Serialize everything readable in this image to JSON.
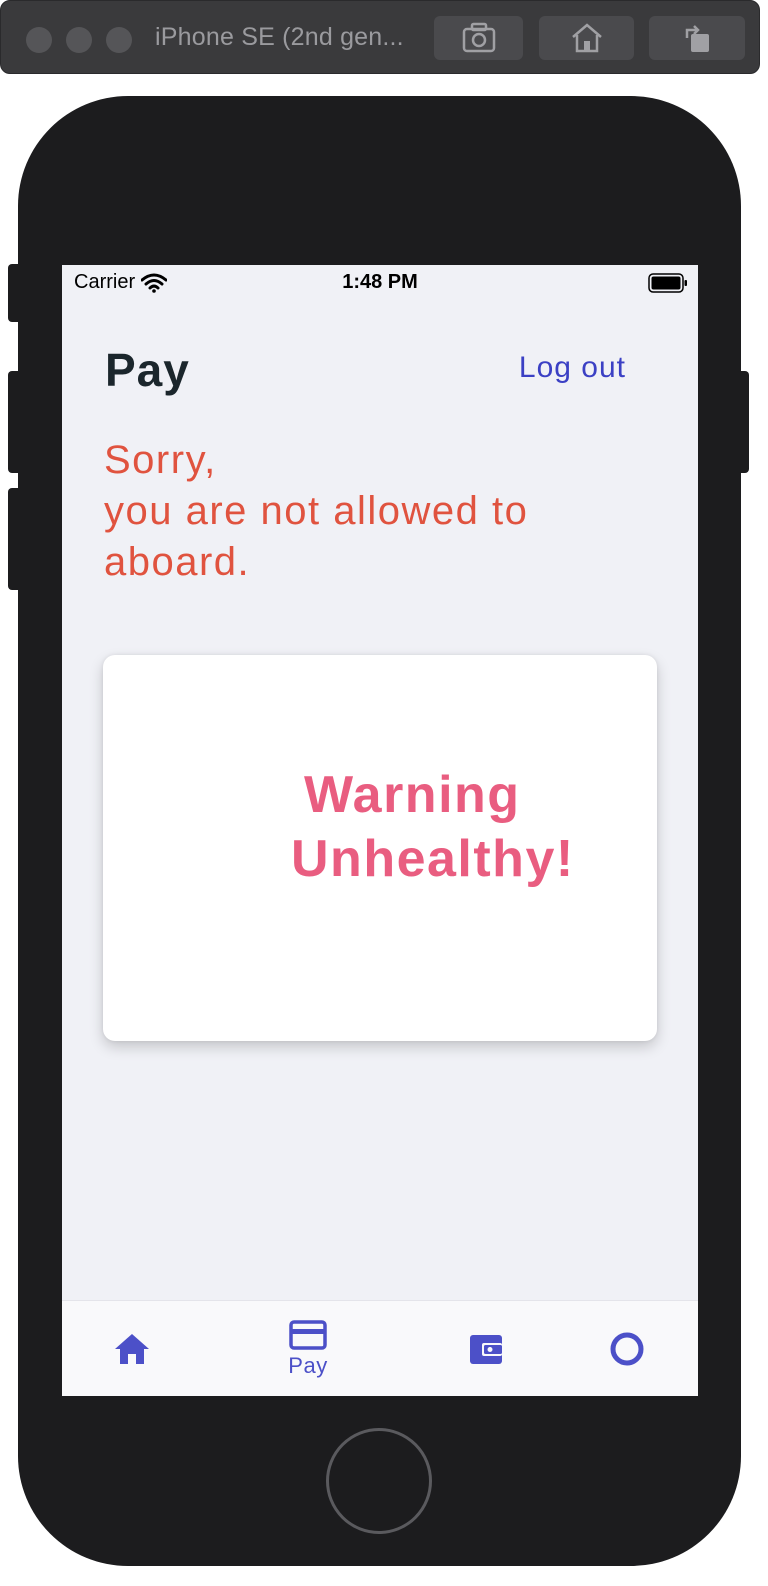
{
  "simulator": {
    "title": "iPhone SE (2nd gen..."
  },
  "status_bar": {
    "carrier": "Carrier",
    "time": "1:48 PM"
  },
  "header": {
    "title": "Pay",
    "logout_label": "Log out"
  },
  "message": {
    "line1": "Sorry,",
    "line2": "you are not allowed to",
    "line3": "aboard."
  },
  "warning_card": {
    "line1": "Warning",
    "line2": "Unhealthy!"
  },
  "tabbar": {
    "tabs": [
      {
        "icon": "home-icon",
        "label": ""
      },
      {
        "icon": "credit-card-icon",
        "label": "Pay",
        "active": true
      },
      {
        "icon": "wallet-icon",
        "label": ""
      },
      {
        "icon": "circle-icon",
        "label": ""
      }
    ]
  },
  "colors": {
    "accent": "#4c50c8",
    "error": "#e0533f",
    "warning": "#e95d80",
    "screen_bg": "#f0f1f6",
    "title": "#1b262c"
  }
}
